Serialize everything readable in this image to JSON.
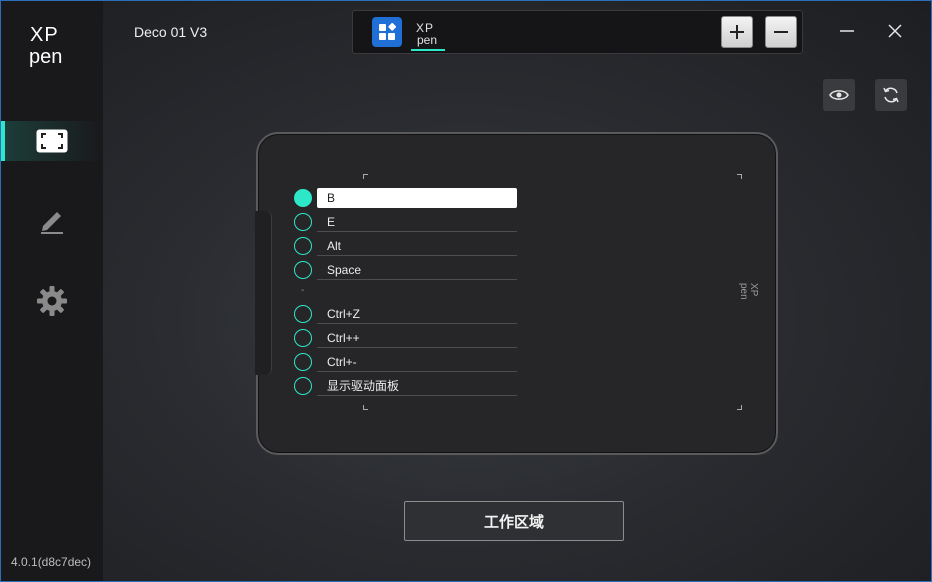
{
  "brand": {
    "logo_text_top": "XP",
    "logo_text_bottom": "pen"
  },
  "titlebar": {
    "device_name": "Deco 01 V3"
  },
  "tabs": [
    {
      "name": "all-apps",
      "icon": "grid-icon"
    },
    {
      "name": "xppen-app",
      "label_top": "XP",
      "label_bottom": "pen",
      "selected": true
    }
  ],
  "sidebar": {
    "items": [
      {
        "name": "tablet-area",
        "icon": "fullscreen-icon",
        "active": true
      },
      {
        "name": "pen",
        "icon": "pen-icon",
        "active": false
      },
      {
        "name": "settings",
        "icon": "gear-icon",
        "active": false
      }
    ],
    "version": "4.0.1(d8c7dec)"
  },
  "keys": [
    {
      "label": "B",
      "selected": true
    },
    {
      "label": "E",
      "selected": false
    },
    {
      "label": "Alt",
      "selected": false
    },
    {
      "label": "Space",
      "selected": false
    },
    {
      "label": "Ctrl+Z",
      "selected": false
    },
    {
      "label": "Ctrl++",
      "selected": false
    },
    {
      "label": "Ctrl+-",
      "selected": false
    },
    {
      "label": "显示驱动面板",
      "selected": false
    }
  ],
  "separator": "-",
  "tablet_logo": {
    "top": "XP",
    "bottom": "pen"
  },
  "work_area_button": "工作区域",
  "colors": {
    "accent": "#2ee6c8",
    "app_blue": "#1f6fd6"
  }
}
